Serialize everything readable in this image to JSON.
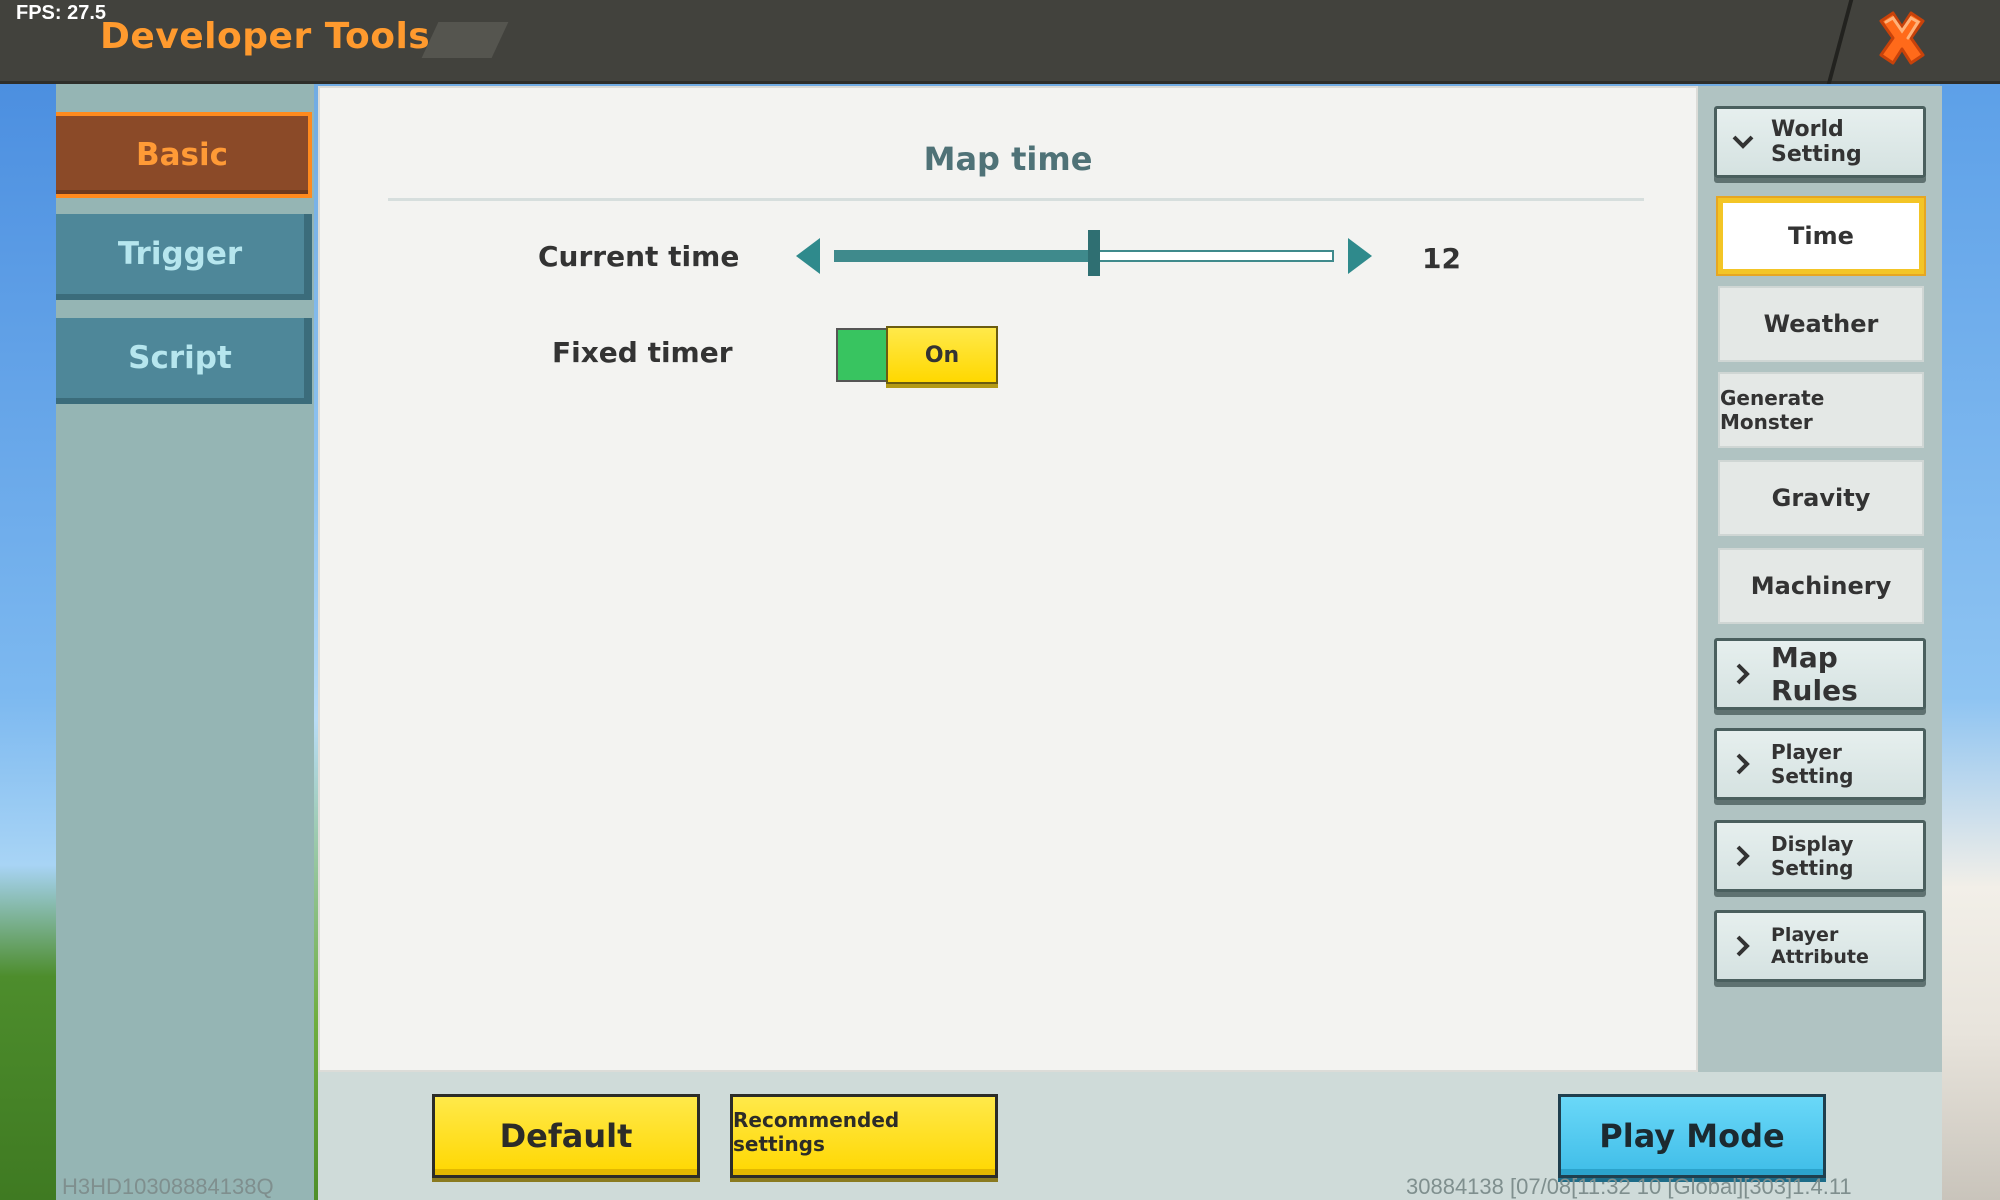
{
  "overlay": {
    "fps": "FPS: 27.5"
  },
  "header": {
    "title": "Developer Tools",
    "close_icon": "close-x-icon",
    "accent_color": "#ff9a2e"
  },
  "left_tabs": [
    {
      "label": "Basic",
      "active": true
    },
    {
      "label": "Trigger",
      "active": false
    },
    {
      "label": "Script",
      "active": false
    }
  ],
  "main": {
    "section_title": "Map time",
    "current_time": {
      "label": "Current time",
      "value": "12",
      "slider_fraction": 0.52
    },
    "fixed_timer": {
      "label": "Fixed timer",
      "state": "On"
    }
  },
  "categories": [
    {
      "label": "World Setting",
      "type": "group",
      "expanded": true
    },
    {
      "label": "Time",
      "type": "item",
      "active": true
    },
    {
      "label": "Weather",
      "type": "item"
    },
    {
      "label": "Generate Monster",
      "type": "item"
    },
    {
      "label": "Gravity",
      "type": "item"
    },
    {
      "label": "Machinery",
      "type": "item"
    },
    {
      "label": "Map Rules",
      "type": "group",
      "expanded": false
    },
    {
      "label": "Player Setting",
      "type": "group",
      "expanded": false
    },
    {
      "label": "Display Setting",
      "type": "group",
      "expanded": false
    },
    {
      "label": "Player Attribute",
      "type": "group",
      "expanded": false
    }
  ],
  "buttons": {
    "default": "Default",
    "recommended": "Recommended settings",
    "play_mode": "Play Mode"
  },
  "footer": {
    "device_id": "H3HD10308884138Q",
    "build_info": "30884138   [07/08[11:32 10  [Global][303]1.4.11"
  },
  "colors": {
    "tab_active": "#8b4a28",
    "tab_inactive": "#4e8799",
    "slider": "#3f8a8c",
    "toggle_on": "#38c460",
    "button_yellow": "#ffd700",
    "button_blue": "#3fbde8",
    "category_highlight": "#f3c526"
  }
}
